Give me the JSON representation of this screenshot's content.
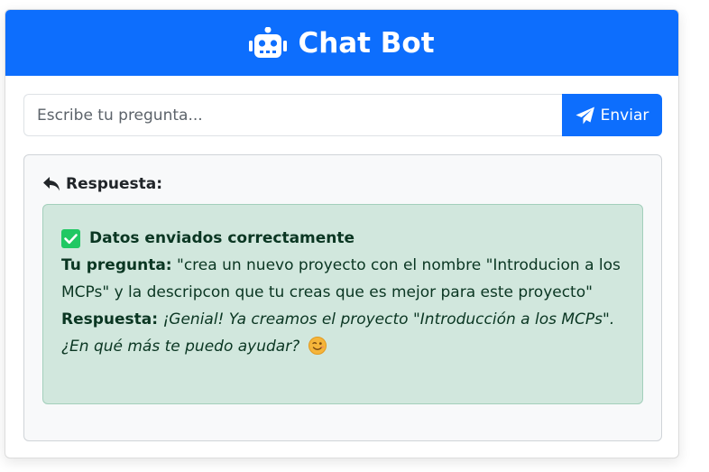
{
  "header": {
    "title": "Chat Bot",
    "icon": "robot-icon"
  },
  "form": {
    "placeholder": "Escribe tu pregunta...",
    "value": "",
    "send_label": "Enviar",
    "send_icon": "paper-plane-icon"
  },
  "response": {
    "heading": "Respuesta:",
    "heading_icon": "reply-icon",
    "alert": {
      "status": "Datos enviados correctamente",
      "status_icon": "check-square-icon",
      "question_label": "Tu pregunta:",
      "question_text": "\"crea un nuevo proyecto con el nombre \"Introducion a los MCPs\" y la descripcon que tu creas que es mejor para este proyecto\"",
      "answer_label": "Respuesta:",
      "answer_text": "¡Genial! Ya creamos el proyecto \"Introducción a los MCPs\". ¿En qué más te puedo ayudar?",
      "answer_emoji": "winking-face-emoji"
    }
  },
  "colors": {
    "primary": "#0d6efd",
    "success_bg": "#d1e7dd",
    "success_text": "#0a3622",
    "check": "#20c863"
  }
}
